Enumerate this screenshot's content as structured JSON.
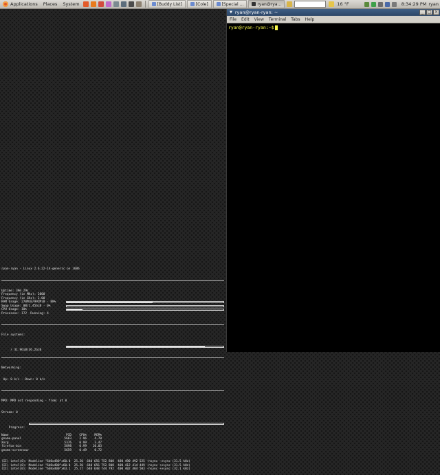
{
  "top_panel": {
    "menus": [
      "Applications",
      "Places",
      "System"
    ],
    "tasks": [
      {
        "label": "[Buddy List]",
        "color": "#6b8bd0"
      },
      {
        "label": "[Cole]",
        "color": "#6b8bd0"
      },
      {
        "label": "[Special ...",
        "color": "#6b8bd0"
      },
      {
        "label": "ryan@rya...",
        "color": "#333333"
      }
    ],
    "weather": "16 °F",
    "clock": "8:34:29 PM",
    "user": "ryan",
    "launcher_colors": [
      "#e35b2a",
      "#e87b1e",
      "#d14c3c",
      "#c06ac9",
      "#7c8a91",
      "#5c6d7c",
      "#4c4c4c",
      "#8c8070"
    ],
    "tray_colors": [
      "#5a8a3c",
      "#3ea04a",
      "#6c6c6c",
      "#4a6aa8",
      "#7a7a7a"
    ]
  },
  "terminal": {
    "title": "ryan@ryan-ryan: ~",
    "menu": [
      "File",
      "Edit",
      "View",
      "Terminal",
      "Tabs",
      "Help"
    ],
    "prompt": "ryan@ryan-ryan:~$",
    "accent": "#fcfc4c"
  },
  "conky": {
    "header": "ryan-ryan - Linux 2.6.22-14-generic on i686",
    "stats": [
      {
        "text": "Uptime: 39m 29s"
      },
      {
        "text": "Frequency (in MHz): 2000"
      },
      {
        "text": "Frequency (in GHz): 2.00"
      },
      {
        "text": "RAM Usage: 270MiB/992MiB - 88%",
        "bar": 55
      },
      {
        "text": "Swap Usage: 0B/1.45GiB - 0%",
        "bar": 0
      },
      {
        "text": "CPU Usage: 10%",
        "bar": 10
      },
      {
        "text": "Processes: 172  Running: 4"
      }
    ],
    "fs_title": "File systems:",
    "fs_line": " / 31.9GiB/36.2GiB",
    "fs_percent": 88,
    "net_title": "Networking:",
    "net_line": " Up: 0 k/s - Down: 0 k/s",
    "mpd_line": "MPD: MPD not responding - from: at 0",
    "mpd_status": "Stream: 0",
    "mpd_progress": "Progress:",
    "progress": 0,
    "proc_header": [
      "Name",
      "PID",
      "CPU%",
      "MEM%"
    ],
    "processes": [
      [
        "gnome-panel",
        "5663",
        "2.96",
        "4.70"
      ],
      [
        "Xorg",
        "5376",
        "0.99",
        "3.47"
      ],
      [
        "firefox-bin",
        "5898",
        "0.99",
        "10.03"
      ],
      [
        "gnome-screensav",
        "5659",
        "0.49",
        "0.72"
      ]
    ],
    "log": [
      "(II) intel(0): Modeline \"640x480\"x60.0  25.20  640 656 752 800  480 490 492 525 -hsync -vsync (31.5 kHz)",
      "(II) intel(0): Modeline \"640x400\"x60.0  25.20  640 656 752 800  400 412 414 449 -hsync +vsync (31.5 kHz)",
      "(II) intel(0): Modeline \"640x400\"x63.1  25.17  640 648 744 792  400 402 404 503 -hsync +vsync (32.1 kHz)"
    ]
  }
}
